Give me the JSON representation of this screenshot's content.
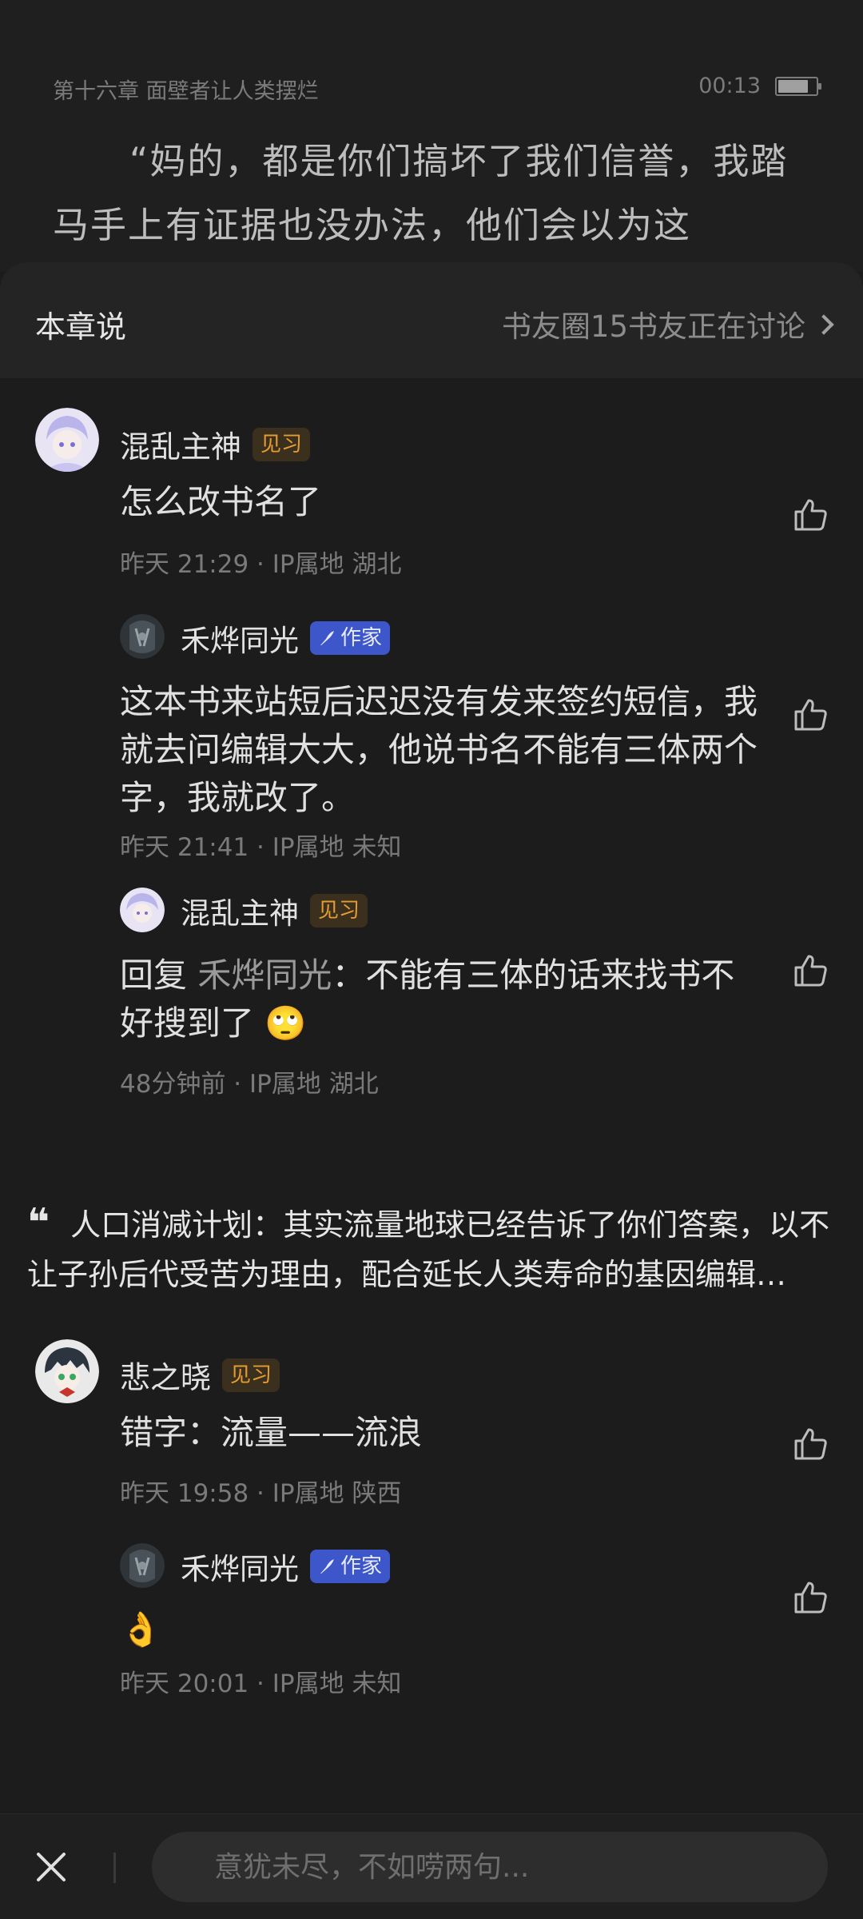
{
  "statusbar": {
    "chapter": "第十六章 面壁者让人类摆烂",
    "time": "00:13",
    "battery_level": 0.8
  },
  "reader": {
    "text": "“妈的，都是你们搞坏了我们信誉，我踏马手上有证据也没办法，他们会以为这"
  },
  "sheet": {
    "title": "本章说",
    "link": "书友圈15书友正在讨论",
    "icons": {
      "chevron": "chevron-right-icon"
    }
  },
  "comments": [
    {
      "name": "混乱主神",
      "badge": "见习",
      "text": "怎么改书名了",
      "meta": "昨天 21:29 · IP属地 湖北",
      "replies": [
        {
          "name": "禾烨同光",
          "badge": "作家",
          "text": "这本书来站短后迟迟没有发来签约短信，我就去问编辑大大，他说书名不能有三体两个字，我就改了。",
          "meta": "昨天 21:41 · IP属地 未知"
        },
        {
          "name": "混乱主神",
          "badge": "见习",
          "reply_prefix": "回复",
          "reply_to": "禾烨同光",
          "text": "：不能有三体的话来找书不好搜到了",
          "emoji": "🙄",
          "meta": "48分钟前 · IP属地 湖北"
        }
      ]
    }
  ],
  "quote": {
    "text": "人口消减计划：其实流量地球已经告诉了你们答案，以不让子孙后代受苦为理由，配合延长人类寿命的基因编辑…"
  },
  "comments2": [
    {
      "name": "悲之晓",
      "badge": "见习",
      "text": "错字：流量——流浪",
      "meta": "昨天 19:58 · IP属地 陕西",
      "replies": [
        {
          "name": "禾烨同光",
          "badge": "作家",
          "text": "👌",
          "meta": "昨天 20:01 · IP属地 未知"
        }
      ]
    }
  ],
  "bottom": {
    "placeholder": "意犹未尽，不如唠两句..."
  }
}
